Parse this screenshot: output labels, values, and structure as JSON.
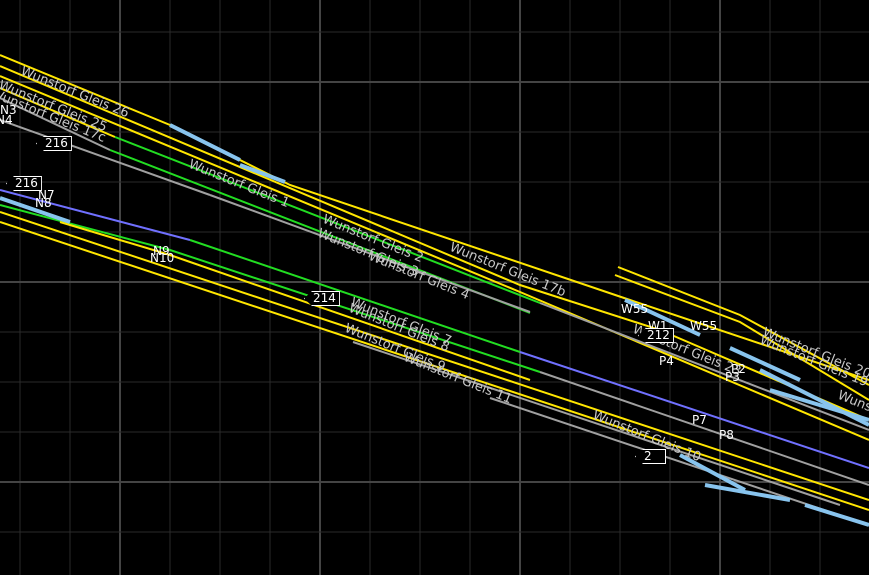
{
  "colors": {
    "main_track": "#ffe600",
    "route_green": "#22dd22",
    "route_purple": "#7070ff",
    "switch": "#88c4ee",
    "plain": "#a0a0a0",
    "grid": "#2a2a2a",
    "grid_major": "#444444"
  },
  "track_labels": [
    "Wunstorf Gleis 26",
    "Wunstorf Gleis 25",
    "Wunstorf Gleis 17c",
    "Wunstorf Gleis 1",
    "Wunstorf Gleis 2",
    "Wunstorf Gleis 3",
    "Wunstorf Gleis 4",
    "Wunstorf Gleis 17b",
    "Wunstorf Gleis 7",
    "Wunstorf Gleis 8",
    "Wunstorf Gleis 9",
    "Wunstorf Gleis 11",
    "Wunstorf Gleis 23",
    "Wunstorf Gleis 20",
    "Wunstorf Gleis 19",
    "Wunstorf Gleis 10",
    "Wuns"
  ],
  "points": [
    "N3",
    "N4",
    "N7",
    "N8",
    "N9",
    "N10",
    "W55",
    "W55",
    "W1",
    "P4",
    "P2",
    "P3",
    "P7",
    "P8"
  ],
  "signals": [
    "216",
    "216",
    "214",
    "212",
    "2"
  ]
}
